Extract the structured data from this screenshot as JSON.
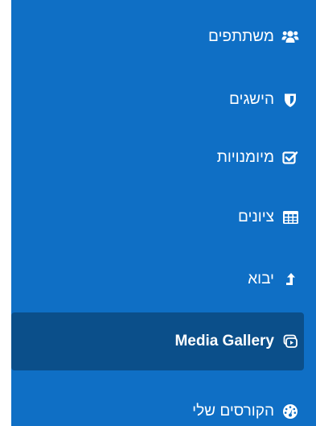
{
  "sidebar": {
    "items": [
      {
        "label": "משתתפים",
        "icon": "users-icon"
      },
      {
        "label": "הישגים",
        "icon": "shield-icon"
      },
      {
        "label": "מיומנויות",
        "icon": "check-square-icon"
      },
      {
        "label": "ציונים",
        "icon": "table-icon"
      },
      {
        "label": "יבוא",
        "icon": "level-up-icon"
      },
      {
        "label": "Media Gallery",
        "icon": "media-gallery-icon",
        "active": true
      },
      {
        "label": "הקורסים שלי",
        "icon": "dashboard-icon"
      }
    ]
  },
  "colors": {
    "sidebar_bg": "#0f6fc5",
    "active_bg": "#0b4f8a",
    "text": "#ffffff"
  }
}
